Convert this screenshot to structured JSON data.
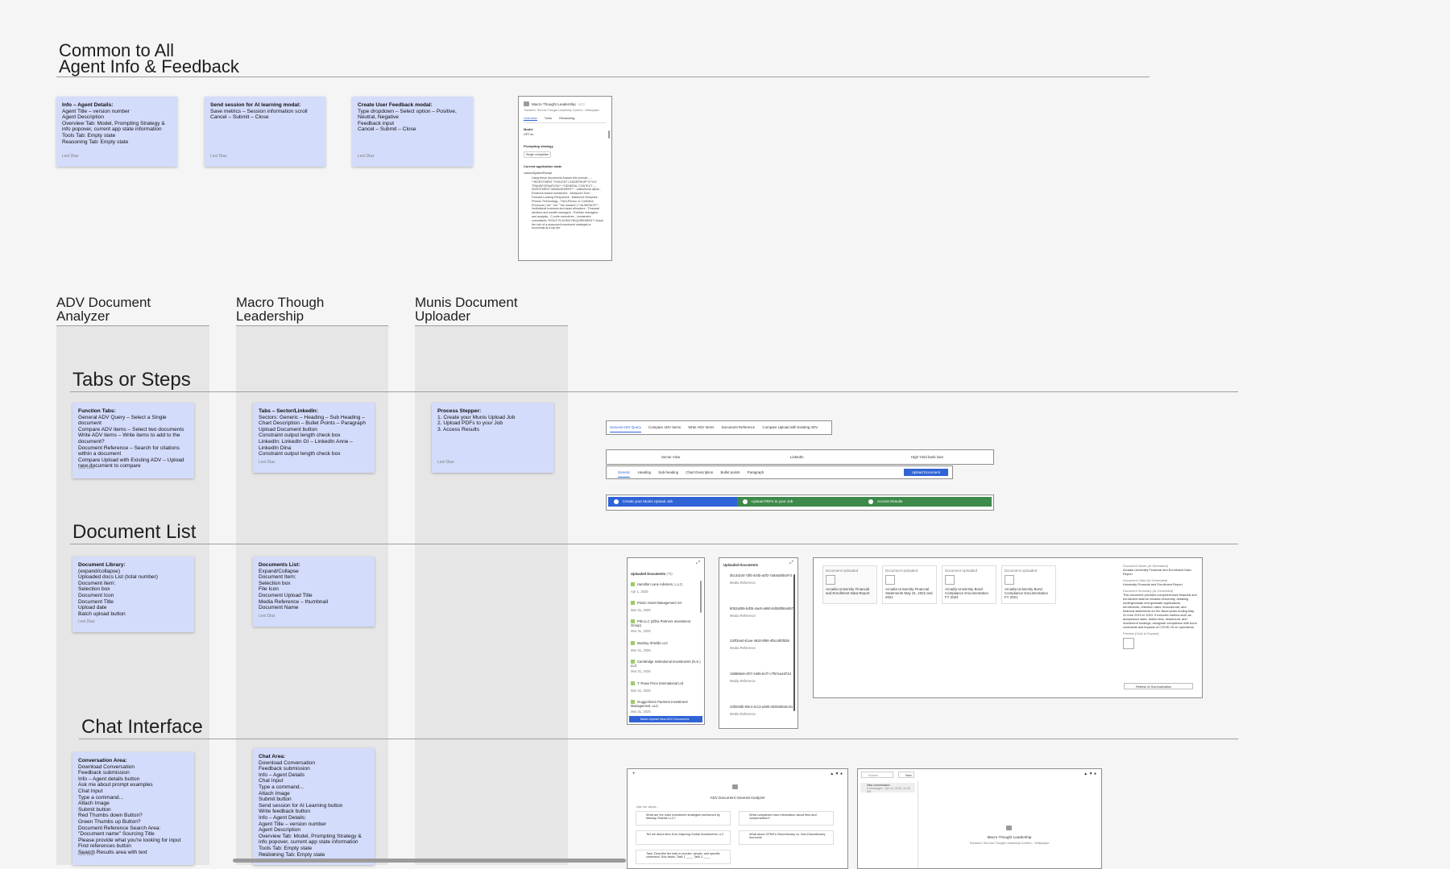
{
  "header": {
    "title_line1": "Common to All",
    "title_line2": "Agent Info & Feedback"
  },
  "top_notes": [
    {
      "title": "Info – Agent Details:",
      "body": "Agent Title – version number\nAgent Description\nOverview Tab: Model, Prompting Strategy & info popover, current app state information\nTools Tab: Empty state\nReasoning Tab: Empty state",
      "author": "Lexi Diaz"
    },
    {
      "title": "Send session for AI learning modal:",
      "body": "Save metrics – Session information scroll\nCancel – Submit – Close",
      "author": "Lexi Diaz"
    },
    {
      "title": "Create User Feedback modal:",
      "body": "Type dropdown – Select option – Positive, Neutral, Negative\nFeedback input\nCancel – Submit – Close",
      "author": "Lexi Diaz"
    }
  ],
  "agent_card": {
    "title": "Macro Thought Leadership",
    "version": "v1.0",
    "subtitle": "Transform Text into Thought Leadership Content – Whitepaper",
    "tabs": [
      "Overview",
      "Tools",
      "Reasoning"
    ],
    "model_label": "Model",
    "model_value": "GPT-4o",
    "strategy_label": "Prompting strategy",
    "strategy_value": "Single completion",
    "state_label": "Current application state",
    "state_key": "customSystemPrompt",
    "state_text": "Using these documents Answer this prompt: --- **INVESTMENT THOUGHT LEADERSHIP STYLE TRANSFORMATION** **GENERAL CONTEXT --- INVESTMENT MANAGEMENT** : Institutional alpha - Evidence-based Investment - Measured Tone - Forward-Looking Perspective - Balanced Viewpoint - Precise Terminology - Third-Person or Collective Pronouns (\"we\" \"our\" \"the Investor\") **AUDIENCE** : Institutional investors and asset allocators - Financial advisors and wealth managers - Portfolio managers and analysts - C-suite executives - Investment committees **ROLE PLAYING REQUIREMENT** Adopt the role of a seasoned investment strategist or economist at a top-tier"
  },
  "columns": [
    {
      "title_line1": "ADV Document",
      "title_line2": "Analyzer"
    },
    {
      "title_line1": "Macro Though",
      "title_line2": "Leadership"
    },
    {
      "title_line1": "Munis Document",
      "title_line2": "Uploader"
    }
  ],
  "sections": {
    "tabs": "Tabs or Steps",
    "doclist": "Document List",
    "chat": "Chat Interface"
  },
  "tabs_notes": [
    {
      "title": "Function Tabs:",
      "body": "General ADV Query – Select a Single document\nCompare ADV items – Select two documents\nWrite ADV items – Write items to add to the document?\nDocument Reference – Search for citations within a document\nCompare Upload with Existing ADV – Upload new document to compare",
      "author": "Lexi Diaz"
    },
    {
      "title": "Tabs – Sector/LinkedIn:",
      "body": "Sectors: Generic – Heading – Sub Heading – Chart Description – Bullet Points – Paragraph\nUpload Document button\nConstraint output length check box\nLinkedIn: LinkedIn GI – LinkedIn Anne – LinkedIn Dina\nConstraint output length check box",
      "author": "Lexi Diaz"
    },
    {
      "title": "Process Stepper:",
      "body": "1. Create your Munis Upload Job\n2. Upload PDFs to your Job\n3. Access Results",
      "author": "Lexi Diaz"
    }
  ],
  "adv_tabs": [
    "General ADV Query",
    "Compare ADV Items",
    "Write ADV Items",
    "Document Reference",
    "Compare Upload with Existing ADV"
  ],
  "macro_top_tabs": [
    "Sector View",
    "LinkedIn",
    "High Yield bank loan"
  ],
  "macro_sub_tabs": [
    "Generic",
    "Heading",
    "Sub-heading",
    "Chart Description",
    "Bullet points",
    "Paragraph"
  ],
  "upload_doc_label": "Upload Document",
  "stepper": [
    "Create your Munis Upload Job",
    "Upload PDFs to your Job",
    "Access Results"
  ],
  "doclist_notes": [
    {
      "title": "Document Library:",
      "body": "(expand/collapse)\nUploaded docs List (total number)\nDocument item:\nSelection box\nDocument Icon\nDocument Title\nUpload date\nBatch upload button",
      "author": "Lexi Diaz"
    },
    {
      "title": "Documents List:",
      "body": "Expand/Collapse\nDocument Item:\nSelection box\nFile Icon\nDocument Upload Title\nMedia Reference – thumbnail\nDocument Name",
      "author": "Lexi Diaz"
    }
  ],
  "uploaded_docs": {
    "title": "Uploaded Documents",
    "count": "(75)",
    "items": [
      {
        "name": "Hamilton Lane Advisors, L.L.C.",
        "date": "Apr 1, 2025"
      },
      {
        "name": "Pinion Asset Management SA",
        "date": "Mar 31, 2025"
      },
      {
        "name": "PIB LLC (d/b/a Partners Investment Group)",
        "date": "Mar 31, 2025"
      },
      {
        "name": "Mackay Shields LLC",
        "date": "Mar 31, 2025"
      },
      {
        "name": "Cambridge Institutional Investments (N.S.) LLC",
        "date": "Mar 31, 2025"
      },
      {
        "name": "T. Rowe Price International Ltd",
        "date": "Mar 31, 2025"
      },
      {
        "name": "Guggenheim Partners Investment Management, LLC",
        "date": "Mar 31, 2025"
      }
    ],
    "batch_label": "Batch Upload New ADV Documents"
  },
  "uploaded_docs2": {
    "title": "Uploaded Documents",
    "media_label": "Media Reference",
    "items": [
      "0bc3cbd4-7df5-404b-a0f3-7a9a0d9bc974",
      "8052a055-bd05-4ae0-a960-8d0d8f84a067",
      "220f2ea0-b1ae-4520-9f60-4f5cc6f0fd36",
      "19d6b6e9-cf07-446b-bcf7-c7f57ea4d743",
      "23f203db-59c4-4c13-a390-eb3918b44c51"
    ]
  },
  "summary_panel": {
    "cards": [
      {
        "label": "Document Uploaded",
        "name": "Arcadia University Financial and Enrollment Data Report"
      },
      {
        "label": "Document Uploaded",
        "name": "Arcadia University Financial Statements May 31, 2022 and 2021"
      },
      {
        "label": "Document Uploaded",
        "name": "Arcadia University Bond Compliance Documentation FY 2024"
      },
      {
        "label": "Document Uploaded",
        "name": "Arcadia University Bond Compliance Documentation FY 2021"
      }
    ],
    "name_label": "Document Name (AI Generated)",
    "name_value": "Arcadia University Financial and Enrollment Data Report",
    "class_label": "Document Class (AI Generated)",
    "class_value": "University Financial and Enrollment Report",
    "summary_label": "Document Summary (AI Generated)",
    "summary_value": "This document provides comprehensive financial and enrollment data for Arcadia University, detailing undergraduate and graduate applications, enrollments, retention rates, financial aid, and financial statements for the fiscal years ending May 31 from 2019 to 2024. It includes metrics such as acceptance rates, tuition fees, headcount, and investment holdings, alongside compliance with bond covenants and impacts of COVID-19 on operations.",
    "preview_label": "Preview (Click to Expand)",
    "refresh_label": "Refresh AI Summarization"
  },
  "chat_notes": [
    {
      "title": "Conversation Area:",
      "body": "Download Conversation\nFeedback submission\nInfo – Agent details button\nAsk me about prompt examples\nChat Input\nType a command...\nAttach Image\nSubmit button\nRed Thumbs down Button?\nGreen Thumbs up Button?\nDocument Reference Search Area:\n\"Document name\" Sourcing Title\nPlease provide what you're looking for input\nFind references button\nSearch Results area with text",
      "author": "Lexi Diaz"
    },
    {
      "title": "Chat Area:",
      "body": "Download Conversation\nFeedback submission\nInfo – Agent Details\nChat Input\nType a command...\nAttach Image\nSubmit button\nSend session for AI Learning button\nWrite feedback button\nInfo – Agent Details:\nAgent Title – version number\nAgent Description\nOverview Tab: Model, Prompting Strategy & info popover, current app state information\nTools Tab: Empty state\nReasoning Tab: Empty state",
      "author": "Lexi Diaz"
    }
  ],
  "chat1": {
    "title": "ADV Document General Analyzer",
    "ask_label": "Ask me about...",
    "prompts": [
      "What are the main investment strategies mentioned by Mackay Shields LLC?",
      "What companies have information about fees and compensation?",
      "Tell me about item 8 for Allspring Global Investments LLC",
      "What about CPNH's Discretionary vs. Non-Discretionary Accounts",
      "Task: Describe the task in precise, simple, and specific command. Sub-tasks: Task 1 ____ Task 2 ____"
    ]
  },
  "chat2": {
    "search_placeholder": "Search",
    "new_label": "New",
    "conversation_label": "New conversation",
    "conversation_meta": "0 messages · Apr 14, 2025, 11:28 AM",
    "title": "Macro Thought Leadership",
    "subtitle": "Transform Text into Thought Leadership Content – Whitepaper"
  }
}
